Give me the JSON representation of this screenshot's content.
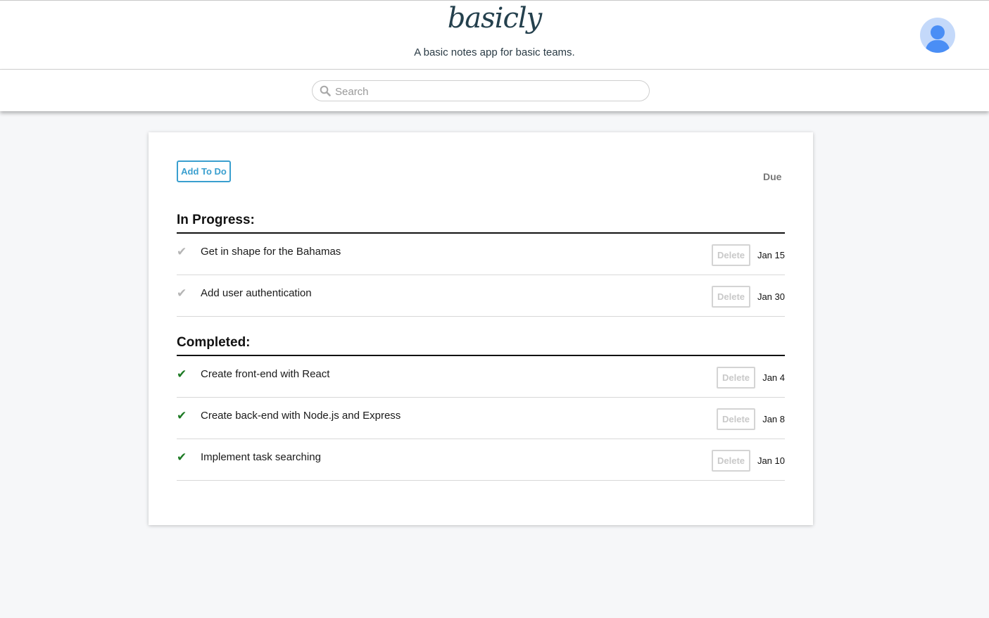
{
  "header": {
    "logo": "basicly",
    "tagline": "A basic notes app for basic teams."
  },
  "search": {
    "placeholder": "Search",
    "value": ""
  },
  "toolbar": {
    "add_label": "Add To Do",
    "due_label": "Due"
  },
  "sections": {
    "in_progress": {
      "title": "In Progress:",
      "items": [
        {
          "text": "Get in shape for the Bahamas",
          "due": "Jan 15",
          "done": false
        },
        {
          "text": "Add user authentication",
          "due": "Jan 30",
          "done": false
        }
      ]
    },
    "completed": {
      "title": "Completed:",
      "items": [
        {
          "text": "Create front-end with React",
          "due": "Jan 4",
          "done": true
        },
        {
          "text": "Create back-end with Node.js and Express",
          "due": "Jan 8",
          "done": true
        },
        {
          "text": "Implement task searching",
          "due": "Jan 10",
          "done": true
        }
      ]
    }
  },
  "labels": {
    "delete": "Delete",
    "check": "✔"
  },
  "colors": {
    "accent": "#3a9fcf",
    "done_check": "#1d7a24",
    "pending_check": "#b5b5b5",
    "logo": "#24404d",
    "avatar_bg": "#c4d9fa",
    "avatar_fg": "#4a8ef5"
  },
  "icons": {
    "search": "search-icon",
    "avatar": "user-avatar-icon"
  }
}
